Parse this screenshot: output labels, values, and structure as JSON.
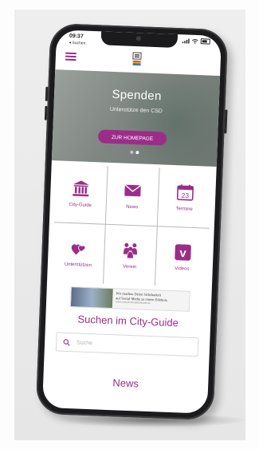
{
  "status": {
    "time": "09:37",
    "back_label": "◂ Suchen"
  },
  "hero": {
    "title": "Spenden",
    "subtitle": "Unterstütze den CSD",
    "button_label": "ZUR HOMEPAGE",
    "slides_total": 2,
    "active_slide": 2
  },
  "tiles": [
    {
      "label": "City-Guide",
      "icon": "bank-icon"
    },
    {
      "label": "News",
      "icon": "envelope-icon"
    },
    {
      "label": "Termine",
      "icon": "calendar-icon",
      "icon_text": "23"
    },
    {
      "label": "Unterstützen",
      "icon": "hearts-icon"
    },
    {
      "label": "Verein",
      "icon": "people-icon"
    },
    {
      "label": "Videos",
      "icon": "vimeo-icon",
      "icon_text": "v"
    }
  ],
  "banner": {
    "line1": "Wir machen Deine Sichtbarkeit",
    "line2": "auf Social Media zu einem Erlebnis.",
    "small": "www.anwalt-im-mittelstand.de"
  },
  "search_section": {
    "title": "Suchen im City-Guide",
    "placeholder": "Suche"
  },
  "news_section": {
    "title": "News"
  },
  "colors": {
    "accent": "#9b2d89"
  }
}
